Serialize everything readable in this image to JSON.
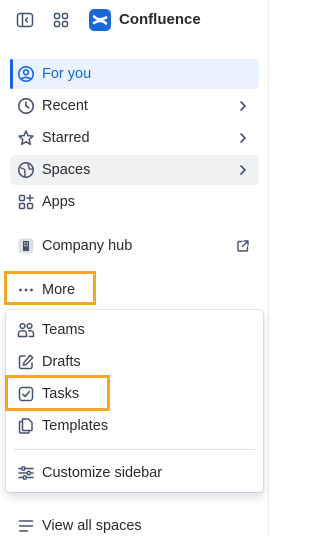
{
  "app": {
    "name": "Confluence",
    "accent": "#1868db",
    "highlight": "#f5a623"
  },
  "topbar": {
    "collapse_icon": "sidebar-collapse-icon",
    "apps_icon": "app-switcher-icon",
    "logo_icon": "confluence-logo-icon"
  },
  "sidebar": {
    "items": [
      {
        "label": "For you",
        "icon": "user-circle-icon",
        "active": true
      },
      {
        "label": "Recent",
        "icon": "clock-icon",
        "chevron": true
      },
      {
        "label": "Starred",
        "icon": "star-icon",
        "chevron": true
      },
      {
        "label": "Spaces",
        "icon": "globe-icon",
        "chevron": true
      },
      {
        "label": "Apps",
        "icon": "apps-add-icon"
      },
      {
        "label": "Company hub",
        "icon": "building-icon",
        "external": true
      },
      {
        "label": "More",
        "icon": "more-dots-icon"
      }
    ],
    "footer": {
      "label": "View all spaces",
      "icon": "list-icon"
    }
  },
  "more_menu": {
    "items": [
      {
        "label": "Teams",
        "icon": "people-icon"
      },
      {
        "label": "Drafts",
        "icon": "edit-icon"
      },
      {
        "label": "Tasks",
        "icon": "checkbox-icon"
      },
      {
        "label": "Templates",
        "icon": "templates-icon"
      }
    ],
    "customize": {
      "label": "Customize sidebar",
      "icon": "customize-icon"
    }
  }
}
